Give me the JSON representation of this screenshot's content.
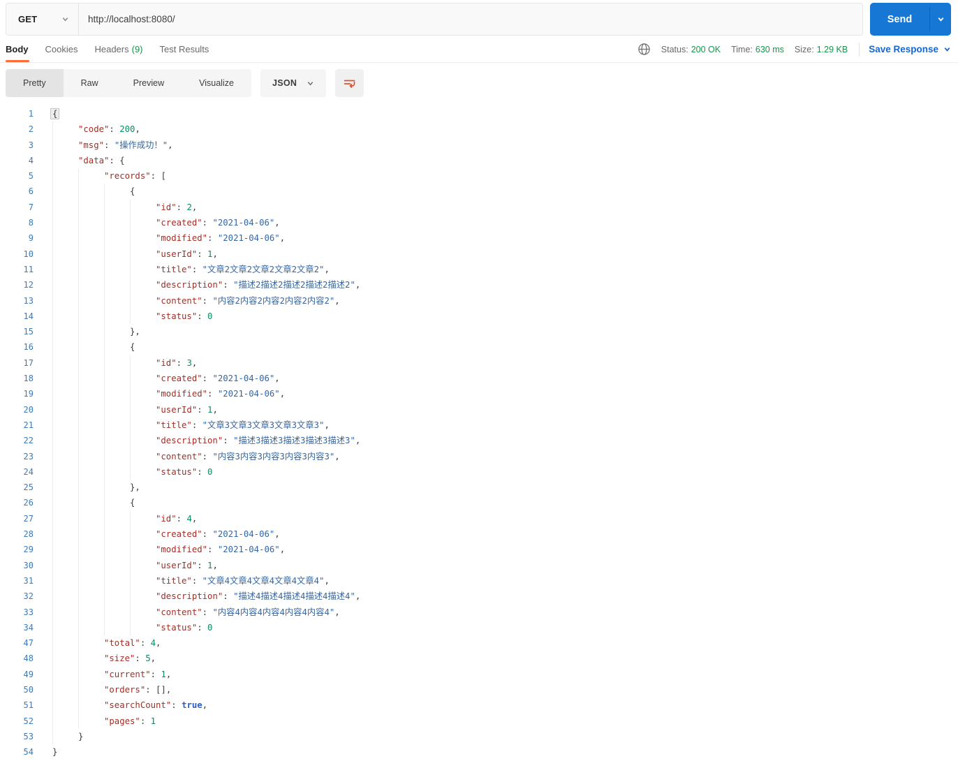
{
  "request": {
    "method": "GET",
    "url": "http://localhost:8080/",
    "send_label": "Send"
  },
  "response_tabs": {
    "items": [
      {
        "label": "Body",
        "count": "",
        "active": true
      },
      {
        "label": "Cookies",
        "count": "",
        "active": false
      },
      {
        "label": "Headers",
        "count": "(9)",
        "active": false
      },
      {
        "label": "Test Results",
        "count": "",
        "active": false
      }
    ]
  },
  "response_meta": {
    "status_label": "Status:",
    "status_value": "200 OK",
    "time_label": "Time:",
    "time_value": "630 ms",
    "size_label": "Size:",
    "size_value": "1.29 KB",
    "save_label": "Save Response"
  },
  "view_toolbar": {
    "modes": [
      "Pretty",
      "Raw",
      "Preview",
      "Visualize"
    ],
    "active_mode": "Pretty",
    "format": "JSON"
  },
  "icons": {
    "method_caret": "chevron-down",
    "send_caret": "chevron-down",
    "save_caret": "chevron-down",
    "format_caret": "chevron-down",
    "network": "globe",
    "wrap": "text-wrap-arrow"
  },
  "colors": {
    "accent_orange": "#ff6c37",
    "wrap_icon_orange": "#e0502a",
    "send_blue": "#1677d4",
    "link_blue": "#1467d2",
    "status_green": "#169549",
    "syntax": {
      "key": "#a32e26",
      "string": "#3566a3",
      "number": "#0f8a5f",
      "boolean": "#2d5ec9",
      "punctuation": "#3a3a3a",
      "line_number": "#3d7ab5"
    }
  },
  "code": {
    "lines": [
      {
        "n": 1,
        "i": 0,
        "t": [
          [
            "m",
            "{"
          ]
        ]
      },
      {
        "n": 2,
        "i": 1,
        "t": [
          [
            "k",
            "\"code\""
          ],
          [
            "p",
            ": "
          ],
          [
            "n",
            "200"
          ],
          [
            "p",
            ","
          ]
        ]
      },
      {
        "n": 3,
        "i": 1,
        "t": [
          [
            "k",
            "\"msg\""
          ],
          [
            "p",
            ": "
          ],
          [
            "s",
            "\"操作成功！\""
          ],
          [
            "p",
            ","
          ]
        ]
      },
      {
        "n": 4,
        "i": 1,
        "t": [
          [
            "k",
            "\"data\""
          ],
          [
            "p",
            ": "
          ],
          [
            "r",
            "{"
          ]
        ]
      },
      {
        "n": 5,
        "i": 2,
        "t": [
          [
            "k",
            "\"records\""
          ],
          [
            "p",
            ": "
          ],
          [
            "r",
            "["
          ]
        ]
      },
      {
        "n": 6,
        "i": 3,
        "t": [
          [
            "r",
            "{"
          ]
        ]
      },
      {
        "n": 7,
        "i": 4,
        "t": [
          [
            "k",
            "\"id\""
          ],
          [
            "p",
            ": "
          ],
          [
            "n",
            "2"
          ],
          [
            "p",
            ","
          ]
        ]
      },
      {
        "n": 8,
        "i": 4,
        "t": [
          [
            "k",
            "\"created\""
          ],
          [
            "p",
            ": "
          ],
          [
            "s",
            "\"2021-04-06\""
          ],
          [
            "p",
            ","
          ]
        ]
      },
      {
        "n": 9,
        "i": 4,
        "t": [
          [
            "k",
            "\"modified\""
          ],
          [
            "p",
            ": "
          ],
          [
            "s",
            "\"2021-04-06\""
          ],
          [
            "p",
            ","
          ]
        ]
      },
      {
        "n": 10,
        "i": 4,
        "t": [
          [
            "k",
            "\"userId\""
          ],
          [
            "p",
            ": "
          ],
          [
            "n",
            "1"
          ],
          [
            "p",
            ","
          ]
        ]
      },
      {
        "n": 11,
        "i": 4,
        "t": [
          [
            "k",
            "\"title\""
          ],
          [
            "p",
            ": "
          ],
          [
            "s",
            "\"文章2文章2文章2文章2文章2\""
          ],
          [
            "p",
            ","
          ]
        ]
      },
      {
        "n": 12,
        "i": 4,
        "t": [
          [
            "k",
            "\"description\""
          ],
          [
            "p",
            ": "
          ],
          [
            "s",
            "\"描述2描述2描述2描述2描述2\""
          ],
          [
            "p",
            ","
          ]
        ]
      },
      {
        "n": 13,
        "i": 4,
        "t": [
          [
            "k",
            "\"content\""
          ],
          [
            "p",
            ": "
          ],
          [
            "s",
            "\"内容2内容2内容2内容2内容2\""
          ],
          [
            "p",
            ","
          ]
        ]
      },
      {
        "n": 14,
        "i": 4,
        "t": [
          [
            "k",
            "\"status\""
          ],
          [
            "p",
            ": "
          ],
          [
            "n",
            "0"
          ]
        ]
      },
      {
        "n": 15,
        "i": 3,
        "t": [
          [
            "r",
            "}"
          ],
          [
            "p",
            ","
          ]
        ]
      },
      {
        "n": 16,
        "i": 3,
        "t": [
          [
            "r",
            "{"
          ]
        ]
      },
      {
        "n": 17,
        "i": 4,
        "t": [
          [
            "k",
            "\"id\""
          ],
          [
            "p",
            ": "
          ],
          [
            "n",
            "3"
          ],
          [
            "p",
            ","
          ]
        ]
      },
      {
        "n": 18,
        "i": 4,
        "t": [
          [
            "k",
            "\"created\""
          ],
          [
            "p",
            ": "
          ],
          [
            "s",
            "\"2021-04-06\""
          ],
          [
            "p",
            ","
          ]
        ]
      },
      {
        "n": 19,
        "i": 4,
        "t": [
          [
            "k",
            "\"modified\""
          ],
          [
            "p",
            ": "
          ],
          [
            "s",
            "\"2021-04-06\""
          ],
          [
            "p",
            ","
          ]
        ]
      },
      {
        "n": 20,
        "i": 4,
        "t": [
          [
            "k",
            "\"userId\""
          ],
          [
            "p",
            ": "
          ],
          [
            "n",
            "1"
          ],
          [
            "p",
            ","
          ]
        ]
      },
      {
        "n": 21,
        "i": 4,
        "t": [
          [
            "k",
            "\"title\""
          ],
          [
            "p",
            ": "
          ],
          [
            "s",
            "\"文章3文章3文章3文章3文章3\""
          ],
          [
            "p",
            ","
          ]
        ]
      },
      {
        "n": 22,
        "i": 4,
        "t": [
          [
            "k",
            "\"description\""
          ],
          [
            "p",
            ": "
          ],
          [
            "s",
            "\"描述3描述3描述3描述3描述3\""
          ],
          [
            "p",
            ","
          ]
        ]
      },
      {
        "n": 23,
        "i": 4,
        "t": [
          [
            "k",
            "\"content\""
          ],
          [
            "p",
            ": "
          ],
          [
            "s",
            "\"内容3内容3内容3内容3内容3\""
          ],
          [
            "p",
            ","
          ]
        ]
      },
      {
        "n": 24,
        "i": 4,
        "t": [
          [
            "k",
            "\"status\""
          ],
          [
            "p",
            ": "
          ],
          [
            "n",
            "0"
          ]
        ]
      },
      {
        "n": 25,
        "i": 3,
        "t": [
          [
            "r",
            "}"
          ],
          [
            "p",
            ","
          ]
        ]
      },
      {
        "n": 26,
        "i": 3,
        "t": [
          [
            "r",
            "{"
          ]
        ]
      },
      {
        "n": 27,
        "i": 4,
        "t": [
          [
            "k",
            "\"id\""
          ],
          [
            "p",
            ": "
          ],
          [
            "n",
            "4"
          ],
          [
            "p",
            ","
          ]
        ]
      },
      {
        "n": 28,
        "i": 4,
        "t": [
          [
            "k",
            "\"created\""
          ],
          [
            "p",
            ": "
          ],
          [
            "s",
            "\"2021-04-06\""
          ],
          [
            "p",
            ","
          ]
        ]
      },
      {
        "n": 29,
        "i": 4,
        "t": [
          [
            "k",
            "\"modified\""
          ],
          [
            "p",
            ": "
          ],
          [
            "s",
            "\"2021-04-06\""
          ],
          [
            "p",
            ","
          ]
        ]
      },
      {
        "n": 30,
        "i": 4,
        "t": [
          [
            "k",
            "\"userId\""
          ],
          [
            "p",
            ": "
          ],
          [
            "n",
            "1"
          ],
          [
            "p",
            ","
          ]
        ]
      },
      {
        "n": 31,
        "i": 4,
        "t": [
          [
            "k",
            "\"title\""
          ],
          [
            "p",
            ": "
          ],
          [
            "s",
            "\"文章4文章4文章4文章4文章4\""
          ],
          [
            "p",
            ","
          ]
        ]
      },
      {
        "n": 32,
        "i": 4,
        "t": [
          [
            "k",
            "\"description\""
          ],
          [
            "p",
            ": "
          ],
          [
            "s",
            "\"描述4描述4描述4描述4描述4\""
          ],
          [
            "p",
            ","
          ]
        ]
      },
      {
        "n": 33,
        "i": 4,
        "t": [
          [
            "k",
            "\"content\""
          ],
          [
            "p",
            ": "
          ],
          [
            "s",
            "\"内容4内容4内容4内容4内容4\""
          ],
          [
            "p",
            ","
          ]
        ]
      },
      {
        "n": 34,
        "i": 4,
        "t": [
          [
            "k",
            "\"status\""
          ],
          [
            "p",
            ": "
          ],
          [
            "n",
            "0"
          ]
        ]
      },
      {
        "n": 47,
        "i": 2,
        "t": [
          [
            "k",
            "\"total\""
          ],
          [
            "p",
            ": "
          ],
          [
            "n",
            "4"
          ],
          [
            "p",
            ","
          ]
        ]
      },
      {
        "n": 48,
        "i": 2,
        "t": [
          [
            "k",
            "\"size\""
          ],
          [
            "p",
            ": "
          ],
          [
            "n",
            "5"
          ],
          [
            "p",
            ","
          ]
        ]
      },
      {
        "n": 49,
        "i": 2,
        "t": [
          [
            "k",
            "\"current\""
          ],
          [
            "p",
            ": "
          ],
          [
            "n",
            "1"
          ],
          [
            "p",
            ","
          ]
        ]
      },
      {
        "n": 50,
        "i": 2,
        "t": [
          [
            "k",
            "\"orders\""
          ],
          [
            "p",
            ": "
          ],
          [
            "r",
            "[]"
          ],
          [
            "p",
            ","
          ]
        ]
      },
      {
        "n": 51,
        "i": 2,
        "t": [
          [
            "k",
            "\"searchCount\""
          ],
          [
            "p",
            ": "
          ],
          [
            "b",
            "true"
          ],
          [
            "p",
            ","
          ]
        ]
      },
      {
        "n": 52,
        "i": 2,
        "t": [
          [
            "k",
            "\"pages\""
          ],
          [
            "p",
            ": "
          ],
          [
            "n",
            "1"
          ]
        ]
      },
      {
        "n": 53,
        "i": 1,
        "t": [
          [
            "r",
            "}"
          ]
        ]
      },
      {
        "n": 54,
        "i": 0,
        "t": [
          [
            "r",
            "}"
          ]
        ]
      }
    ]
  }
}
